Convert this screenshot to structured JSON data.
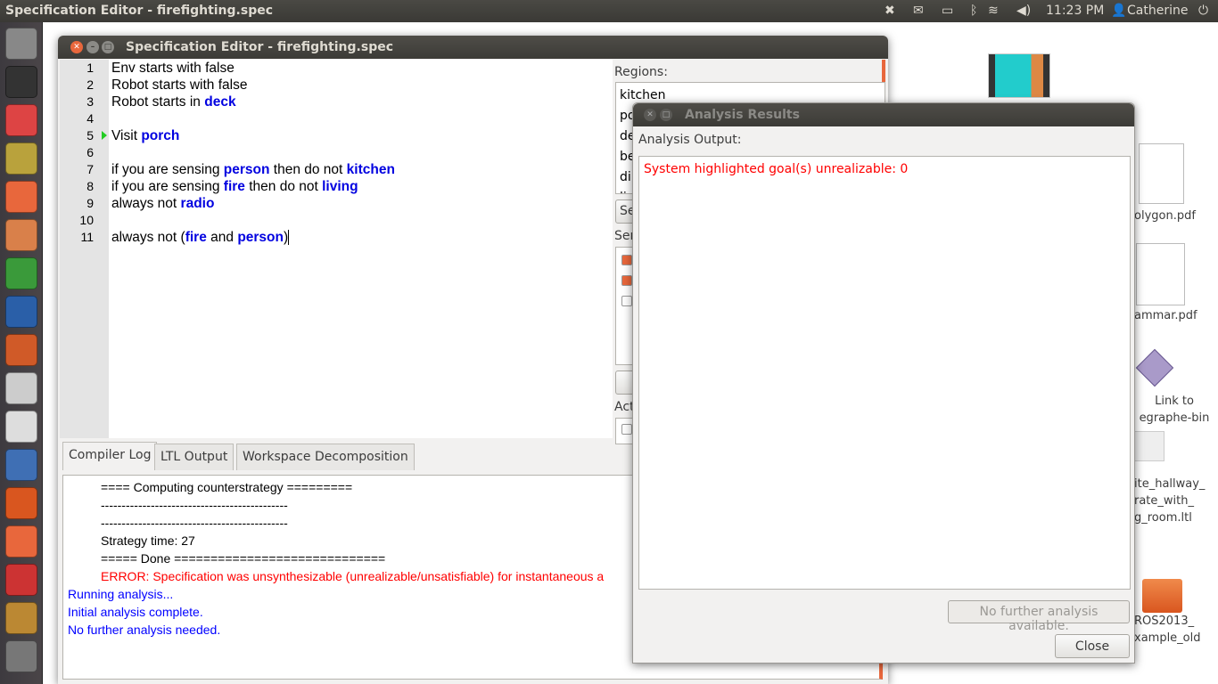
{
  "topbar": {
    "title": "Specification Editor - firefighting.spec",
    "time": "11:23 PM",
    "user": "Catherine",
    "icons": [
      "dropbox-icon",
      "mail-icon",
      "battery-icon",
      "bluetooth-icon",
      "wifi-icon",
      "volume-icon",
      "user-icon",
      "power-icon"
    ]
  },
  "launcher": {
    "icons": [
      "ubuntu-dash-icon",
      "terminal-icon",
      "chrome-icon",
      "archive-manager-icon",
      "files-icon",
      "home-folder-icon",
      "calc-icon",
      "writer-icon",
      "impress-icon",
      "text-editor-icon",
      "texmaker-icon",
      "network-icon",
      "software-center-icon",
      "ubuntu-one-icon",
      "app-icon",
      "stacked-apps-icon",
      "trash-icon"
    ]
  },
  "editor": {
    "title": "Specification Editor - firefighting.spec",
    "lines": [
      {
        "n": "1",
        "parts": [
          {
            "t": "Env starts with false",
            "k": false
          }
        ]
      },
      {
        "n": "2",
        "parts": [
          {
            "t": "Robot starts with false",
            "k": false
          }
        ]
      },
      {
        "n": "3",
        "parts": [
          {
            "t": "Robot starts in ",
            "k": false
          },
          {
            "t": "deck",
            "k": true
          }
        ]
      },
      {
        "n": "4",
        "parts": []
      },
      {
        "n": "5",
        "parts": [
          {
            "t": "Visit ",
            "k": false
          },
          {
            "t": "porch",
            "k": true
          }
        ]
      },
      {
        "n": "6",
        "parts": []
      },
      {
        "n": "7",
        "parts": [
          {
            "t": "if you are sensing ",
            "k": false
          },
          {
            "t": "person",
            "k": true
          },
          {
            "t": " then do not ",
            "k": false
          },
          {
            "t": "kitchen",
            "k": true
          }
        ]
      },
      {
        "n": "8",
        "parts": [
          {
            "t": "if you are sensing ",
            "k": false
          },
          {
            "t": "fire",
            "k": true
          },
          {
            "t": " then do not ",
            "k": false
          },
          {
            "t": "living",
            "k": true
          }
        ]
      },
      {
        "n": "9",
        "parts": [
          {
            "t": "always not ",
            "k": false
          },
          {
            "t": "radio",
            "k": true
          }
        ]
      },
      {
        "n": "10",
        "parts": []
      },
      {
        "n": "11",
        "parts": [
          {
            "t": "always not (",
            "k": false
          },
          {
            "t": "fire",
            "k": true
          },
          {
            "t": " and ",
            "k": false
          },
          {
            "t": "person",
            "k": true
          },
          {
            "t": ")",
            "k": false
          }
        ]
      }
    ],
    "side": {
      "regions_label": "Regions:",
      "regions": [
        "kitchen",
        "po",
        "de",
        "be",
        "di",
        "li"
      ],
      "select_button": "Se",
      "sensors_label": "Ser",
      "sensors_checked": [
        true,
        true,
        false
      ],
      "actions_label": "Act",
      "actions_checked": [
        false
      ]
    },
    "tabs": [
      "Compiler Log",
      "LTL Output",
      "Workspace Decomposition"
    ],
    "log": [
      {
        "t": "==== Computing counterstrategy =========",
        "c": "#000",
        "indent": true
      },
      {
        "t": "---------------------------------------------",
        "c": "#000",
        "indent": true
      },
      {
        "t": "---------------------------------------------",
        "c": "#000",
        "indent": true
      },
      {
        "t": "Strategy time: 27",
        "c": "#000",
        "indent": true
      },
      {
        "t": "===== Done =============================",
        "c": "#000",
        "indent": true
      },
      {
        "t": "ERROR: Specification was unsynthesizable (unrealizable/unsatisfiable) for instantaneous a",
        "c": "#ff0000",
        "indent": true
      },
      {
        "t": "Running analysis...",
        "c": "#0000ff",
        "indent": false
      },
      {
        "t": "Initial analysis complete.",
        "c": "#0000ff",
        "indent": false
      },
      {
        "t": "No further analysis needed.",
        "c": "#0000ff",
        "indent": false
      }
    ]
  },
  "dialog": {
    "title": "Analysis Results",
    "output_label": "Analysis Output:",
    "output": "System highlighted goal(s) unrealizable: 0",
    "further_button": "No further analysis available.",
    "close_button": "Close"
  },
  "desktop": [
    {
      "label": "olygon.pdf",
      "icon": "pdf-document-icon"
    },
    {
      "label": "ammar.pdf",
      "icon": "pdf-document-icon"
    },
    {
      "label": "Link to\negraphe-bin",
      "icon": "link-icon"
    },
    {
      "label": "ite_hallway_\nrate_with_\ng_room.ltl",
      "icon": "text-file-icon"
    },
    {
      "label": "ROS2013_\nxample_old",
      "icon": "folder-icon"
    }
  ],
  "colors": {
    "accent": "#e8673c",
    "keyword": "#0000e0",
    "error": "#ff0000",
    "info": "#0000ff"
  }
}
